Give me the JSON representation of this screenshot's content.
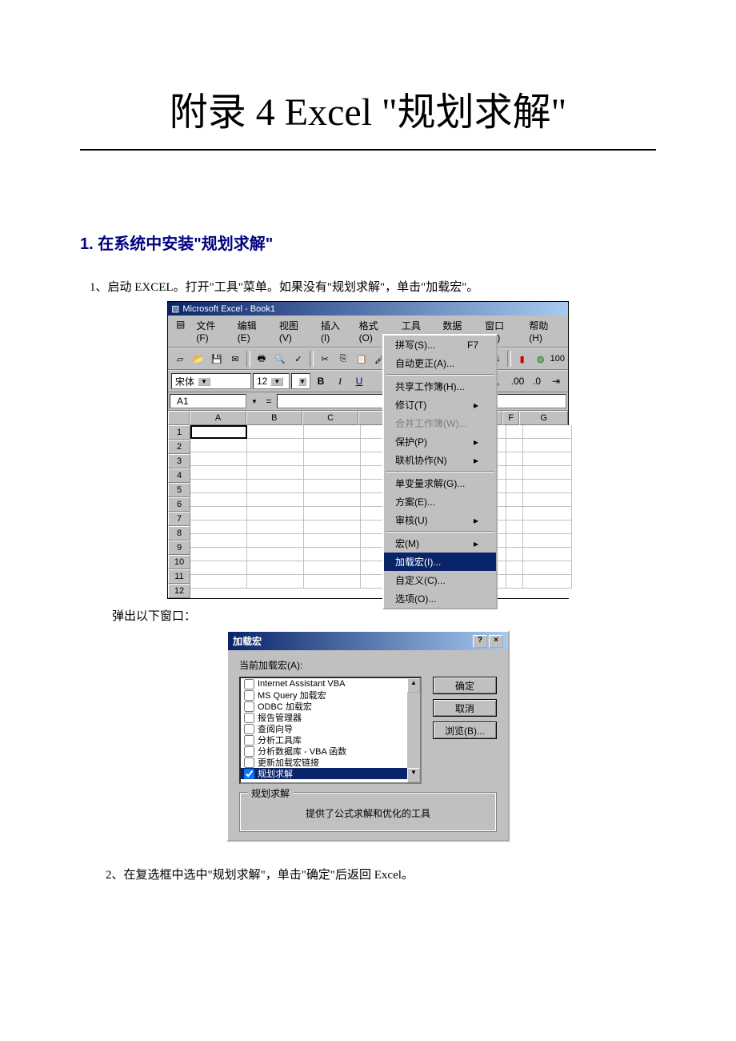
{
  "doc": {
    "title": "附录 4 Excel \"规划求解\"",
    "section1": "1. 在系统中安装\"规划求解\"",
    "step1": "1、启动 EXCEL。打开\"工具\"菜单。如果没有\"规划求解\"，单击\"加载宏\"。",
    "popup_text": "弹出以下窗口：",
    "step2": "2、在复选框中选中\"规划求解\"，单击\"确定\"后返回 Excel。"
  },
  "excel": {
    "title": "Microsoft Excel - Book1",
    "menus": {
      "file": "文件(F)",
      "edit": "编辑(E)",
      "view": "视图(V)",
      "insert": "插入(I)",
      "format": "格式(O)",
      "tools": "工具(T)",
      "data": "数据(D)",
      "window": "窗口(W)",
      "help": "帮助(H)"
    },
    "font": "宋体",
    "fontsize": "12",
    "namebox": "A1",
    "formula_eq": "=",
    "bold": "B",
    "italic": "I",
    "underline": "U",
    "toolbar_right": {
      "sort_asc": "A↓",
      "sort_desc": "Z↓",
      "percent": "100"
    },
    "format_right": {
      "comma": ",",
      "inc_dec": ".00",
      "dec_dec": ".0"
    },
    "cols": [
      "A",
      "B",
      "C",
      "",
      "F",
      "G"
    ],
    "rows": [
      "1",
      "2",
      "3",
      "4",
      "5",
      "6",
      "7",
      "8",
      "9",
      "10",
      "11",
      "12"
    ],
    "tools_menu": {
      "spell": "拼写(S)...",
      "spell_key": "F7",
      "autocorrect": "自动更正(A)...",
      "share": "共享工作簿(H)...",
      "track": "修订(T)",
      "merge": "合并工作簿(W)...",
      "protect": "保护(P)",
      "online": "联机协作(N)",
      "goal": "单变量求解(G)...",
      "scenarios": "方案(E)...",
      "audit": "审核(U)",
      "macro": "宏(M)",
      "addins": "加载宏(I)...",
      "customize": "自定义(C)...",
      "options": "选项(O)..."
    }
  },
  "addins": {
    "title": "加载宏",
    "label": "当前加载宏(A):",
    "items": [
      "Internet Assistant VBA",
      "MS Query 加载宏",
      "ODBC 加载宏",
      "报告管理器",
      "查阅向导",
      "分析工具库",
      "分析数据库 - VBA 函数",
      "更新加载宏链接",
      "规划求解"
    ],
    "ok": "确定",
    "cancel": "取消",
    "browse": "浏览(B)...",
    "group_title": "规划求解",
    "desc": "提供了公式求解和优化的工具"
  }
}
